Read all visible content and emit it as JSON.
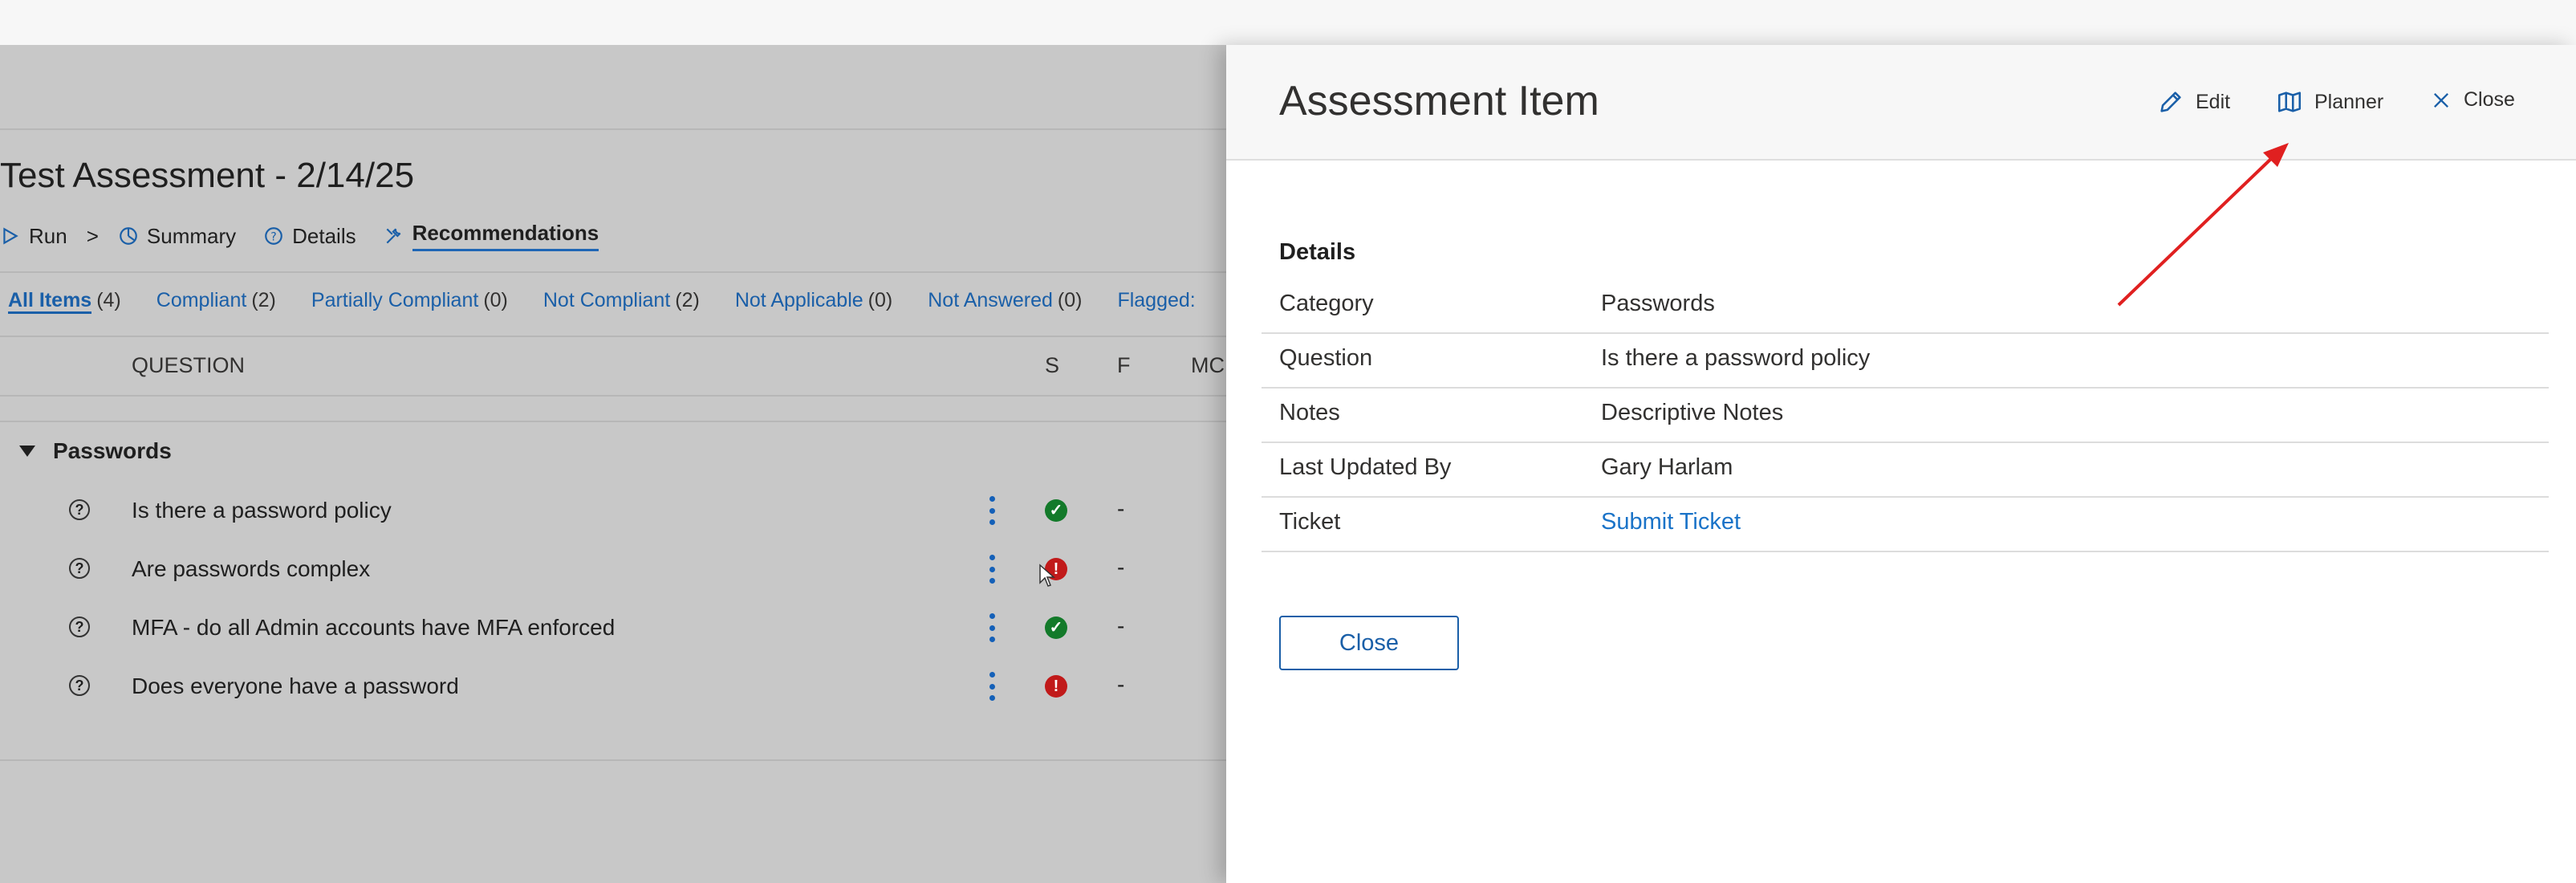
{
  "background": {
    "title": "Test Assessment - 2/14/25",
    "nav": [
      {
        "label": "Run",
        "icon": "run-icon"
      },
      {
        "label": "Summary",
        "icon": "pie-chart-icon"
      },
      {
        "label": "Details",
        "icon": "question-circle-icon"
      },
      {
        "label": "Recommendations",
        "icon": "tools-icon",
        "active": true
      }
    ],
    "nav_separator": ">",
    "filters": [
      {
        "label": "All Items",
        "count": "(4)",
        "active": true
      },
      {
        "label": "Compliant",
        "count": "(2)"
      },
      {
        "label": "Partially Compliant",
        "count": "(0)"
      },
      {
        "label": "Not Compliant",
        "count": "(2)"
      },
      {
        "label": "Not Applicable",
        "count": "(0)"
      },
      {
        "label": "Not Answered",
        "count": "(0)"
      },
      {
        "label": "Flagged:",
        "count": ""
      }
    ],
    "columns": {
      "question": "QUESTION",
      "s": "S",
      "f": "F",
      "mc": "MC"
    },
    "group": "Passwords",
    "rows": [
      {
        "question": "Is there a password policy",
        "status": "compliant",
        "status_glyph": "✓",
        "f": "-"
      },
      {
        "question": "Are passwords complex",
        "status": "not-compliant",
        "status_glyph": "!",
        "f": "-"
      },
      {
        "question": "MFA - do all Admin accounts have MFA enforced",
        "status": "compliant",
        "status_glyph": "✓",
        "f": "-"
      },
      {
        "question": "Does everyone have a password",
        "status": "not-compliant",
        "status_glyph": "!",
        "f": "-"
      }
    ],
    "question_icon_glyph": "?"
  },
  "panel": {
    "title": "Assessment Item",
    "actions": {
      "edit": "Edit",
      "planner": "Planner",
      "close": "Close"
    },
    "section_title": "Details",
    "details": [
      {
        "key": "Category",
        "value": "Passwords"
      },
      {
        "key": "Question",
        "value": "Is there a password policy"
      },
      {
        "key": "Notes",
        "value": "Descriptive Notes"
      },
      {
        "key": "Last Updated By",
        "value": "Gary Harlam"
      },
      {
        "key": "Ticket",
        "value": "Submit Ticket",
        "link": true
      }
    ],
    "close_button": "Close"
  },
  "colors": {
    "accent": "#1a5fa8",
    "link": "#1a73c8",
    "compliant": "#137a2a",
    "not_compliant": "#c11a1a",
    "annotation_arrow": "#e02020"
  }
}
